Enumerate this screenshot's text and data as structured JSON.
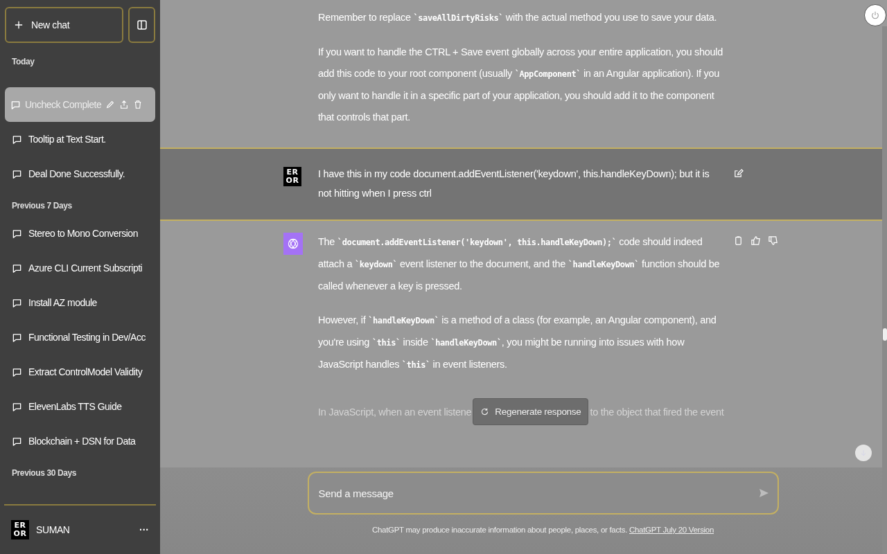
{
  "sidebar": {
    "new_chat": "New chat",
    "sections": [
      {
        "heading": "Today",
        "items": [
          {
            "title": "Uncheck Complete",
            "selected": true
          },
          {
            "title": "Tooltip at Text Start.",
            "selected": false
          },
          {
            "title": "Deal Done Successfully.",
            "selected": false
          }
        ]
      },
      {
        "heading": "Previous 7 Days",
        "items": [
          {
            "title": "Stereo to Mono Conversion",
            "selected": false
          },
          {
            "title": "Azure CLI Current Subscripti",
            "selected": false
          },
          {
            "title": "Install AZ module",
            "selected": false
          },
          {
            "title": "Functional Testing in Dev/Acc",
            "selected": false
          },
          {
            "title": "Extract ControlModel Validity",
            "selected": false
          },
          {
            "title": "ElevenLabs TTS Guide",
            "selected": false
          },
          {
            "title": "Blockchain + DSN for Data",
            "selected": false
          }
        ]
      },
      {
        "heading": "Previous 30 Days"
      }
    ],
    "user": {
      "avatar": [
        "ER",
        "OR"
      ],
      "name": "SUMAN",
      "more": "···"
    }
  },
  "messages": [
    {
      "kind": "assistant",
      "paragraphs": [
        [
          {
            "code": false,
            "text": "Remember to replace "
          },
          {
            "code": true,
            "text": "`saveAllDirtyRisks`"
          },
          {
            "code": false,
            "text": " with the actual method you use to save your data."
          }
        ],
        [
          {
            "code": false,
            "text": "If you want to handle the CTRL + Save event globally across your entire application, you should add this code to your root component (usually "
          },
          {
            "code": true,
            "text": "`AppComponent`"
          },
          {
            "code": false,
            "text": " in an Angular application). If you only want to handle it in a specific part of your application, you should add it to the component that controls that part."
          }
        ]
      ]
    },
    {
      "kind": "user",
      "avatar": [
        "ER",
        "OR"
      ],
      "paragraphs": [
        [
          {
            "code": false,
            "text": "I have this in my code document.addEventListener('keydown', this.handleKeyDown); but it is not hitting when I press ctrl"
          }
        ]
      ]
    },
    {
      "kind": "assistant",
      "avatar": true,
      "paragraphs": [
        [
          {
            "code": false,
            "text": "The "
          },
          {
            "code": true,
            "text": "`document.addEventListener('keydown', this.handleKeyDown);`"
          },
          {
            "code": false,
            "text": " code should indeed attach a "
          },
          {
            "code": true,
            "text": "`keydown`"
          },
          {
            "code": false,
            "text": " event listener to the document, and the "
          },
          {
            "code": true,
            "text": "`handleKeyDown`"
          },
          {
            "code": false,
            "text": " function should be called whenever a key is pressed."
          }
        ],
        [
          {
            "code": false,
            "text": "However, if "
          },
          {
            "code": true,
            "text": "`handleKeyDown`"
          },
          {
            "code": false,
            "text": " is a method of a class (for example, an Angular component), and you're using "
          },
          {
            "code": true,
            "text": "`this`"
          },
          {
            "code": false,
            "text": " inside "
          },
          {
            "code": true,
            "text": "`handleKeyDown`"
          },
          {
            "code": false,
            "text": ", you might be running into issues with how JavaScript handles "
          },
          {
            "code": true,
            "text": "`this`"
          },
          {
            "code": false,
            "text": " in event listeners."
          }
        ]
      ]
    }
  ],
  "faded_line": [
    "In JavaScript, when an event listene",
    "to the object that fired the event"
  ],
  "regenerate": "Regenerate response",
  "composer": {
    "placeholder": "Send a message"
  },
  "footer": {
    "note": "ChatGPT may produce inaccurate information about people, places, or facts.",
    "link": "ChatGPT July 20 Version"
  }
}
